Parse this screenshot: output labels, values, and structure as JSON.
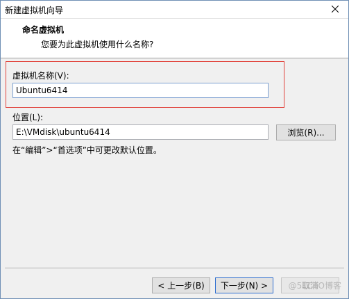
{
  "window": {
    "title": "新建虚拟机向导",
    "close_icon": "close-icon"
  },
  "header": {
    "title": "命名虚拟机",
    "subtitle": "您要为此虚拟机使用什么名称?"
  },
  "form": {
    "name_label": "虚拟机名称(V):",
    "name_value": "Ubuntu6414",
    "location_label": "位置(L):",
    "location_value": "E:\\VMdisk\\ubuntu6414",
    "browse_label": "浏览(R)...",
    "hint": "在“编辑”>“首选项”中可更改默认位置。"
  },
  "buttons": {
    "back_label": "< 上一步(B)",
    "next_label": "下一步(N) >",
    "cancel_label": "取消"
  },
  "overlay": {
    "watermark": "@51CTO博客"
  },
  "colors": {
    "highlight_border": "#e1413a",
    "default_button_border": "#2f6fd0",
    "input_focus_border": "#7a9ecf"
  }
}
